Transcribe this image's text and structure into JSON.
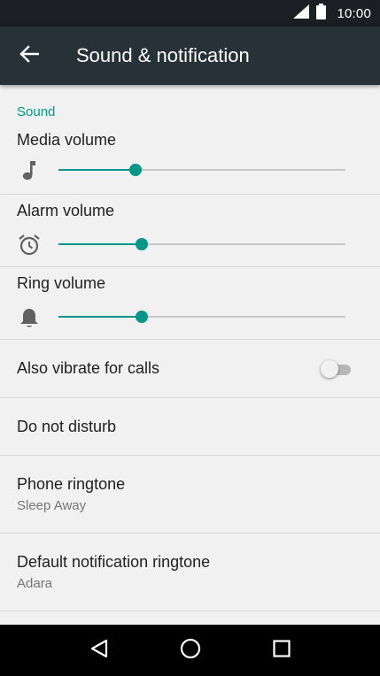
{
  "status_bar": {
    "time": "10:00",
    "icons": [
      "signal-icon",
      "battery-icon"
    ]
  },
  "app_bar": {
    "title": "Sound & notification",
    "back_icon": "arrow-back-icon"
  },
  "sound_section": {
    "header": "Sound",
    "accent_color": "#009688",
    "sliders": [
      {
        "label": "Media volume",
        "icon": "music-note-icon",
        "level": 0.27
      },
      {
        "label": "Alarm volume",
        "icon": "alarm-clock-icon",
        "level": 0.29
      },
      {
        "label": "Ring volume",
        "icon": "bell-icon",
        "level": 0.29
      }
    ]
  },
  "settings": {
    "vibrate": {
      "label": "Also vibrate for calls",
      "enabled": false
    },
    "do_not_disturb": {
      "label": "Do not disturb"
    },
    "phone_ringtone": {
      "label": "Phone ringtone",
      "value": "Sleep Away"
    },
    "notification_ringtone": {
      "label": "Default notification ringtone",
      "value": "Adara"
    }
  },
  "nav_bar": {
    "icons": [
      "back-triangle-icon",
      "home-circle-icon",
      "recents-square-icon"
    ]
  }
}
